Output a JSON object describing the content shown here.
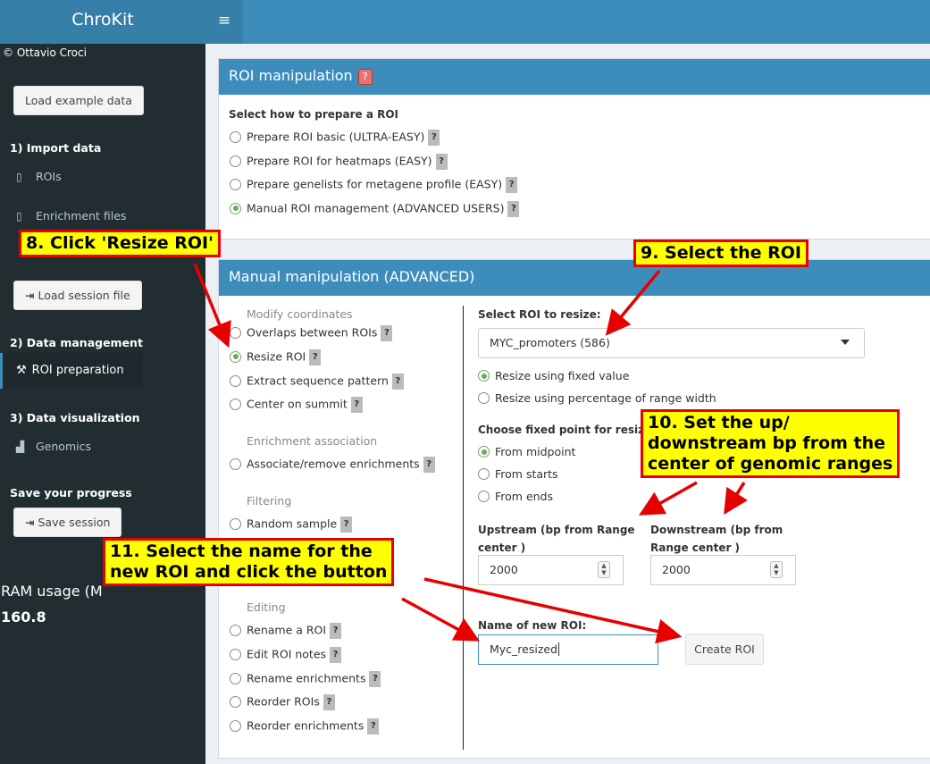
{
  "header": {
    "app_title": "ChroKit",
    "menu_icon": "hamburger-icon",
    "toggle_glyph": "≡"
  },
  "sidebar": {
    "copyright": "© Ottavio Croci",
    "load_example_label": "Load example data",
    "import_heading": "1) Import data",
    "rois_label": "ROIs",
    "enrichment_label": "Enrichment files",
    "load_session_label": "Load session file",
    "data_mgmt_heading": "2) Data management",
    "roi_prep_label": "ROI preparation",
    "data_vis_heading": "3) Data visualization",
    "genomics_label": "Genomics",
    "save_heading": "Save your progress",
    "save_session_label": "Save session",
    "ram_label": "RAM usage (M",
    "ram_value": "160.8"
  },
  "roi_box": {
    "title": "ROI manipulation",
    "help": "?",
    "prompt": "Select how to prepare a ROI",
    "options": [
      {
        "label": "Prepare ROI basic (ULTRA-EASY)",
        "selected": false
      },
      {
        "label": "Prepare ROI for heatmaps (EASY)",
        "selected": false
      },
      {
        "label": "Prepare genelists for metagene profile (EASY)",
        "selected": false
      },
      {
        "label": "Manual ROI management (ADVANCED USERS)",
        "selected": true
      }
    ]
  },
  "manual_box": {
    "title": "Manual manipulation (ADVANCED)",
    "groups": {
      "modify": "Modify coordinates",
      "enrichment": "Enrichment association",
      "filtering": "Filtering",
      "editing": "Editing"
    },
    "actions": {
      "overlaps": "Overlaps between ROIs",
      "resize": "Resize ROI",
      "extract": "Extract sequence pattern",
      "center": "Center on summit",
      "associate": "Associate/remove enrichments",
      "random": "Random sample",
      "rename_roi": "Rename a ROI",
      "edit_notes": "Edit ROI notes",
      "rename_enrich": "Rename enrichments",
      "reorder_rois": "Reorder ROIs",
      "reorder_enrich": "Reorder enrichments"
    },
    "selected_action": "resize",
    "resize_panel": {
      "select_label": "Select ROI to resize:",
      "select_value": "MYC_promoters (586)",
      "mode_fixed": "Resize using fixed value",
      "mode_percent": "Resize using percentage of range width",
      "mode_selected": "fixed",
      "fixed_point_label": "Choose fixed point for resize:",
      "fp_midpoint": "From midpoint",
      "fp_starts": "From starts",
      "fp_ends": "From ends",
      "fp_selected": "midpoint",
      "upstream_label_1": "Upstream (bp from Range",
      "upstream_label_2": "center )",
      "upstream_value": "2000",
      "downstream_label_1": "Downstream (bp from",
      "downstream_label_2": "Range center )",
      "downstream_value": "2000",
      "name_label": "Name of new ROI:",
      "name_value": "Myc_resized",
      "create_label": "Create ROI"
    }
  },
  "callouts": {
    "c8": "8. Click 'Resize ROI'",
    "c9": "9. Select the ROI",
    "c10": "10. Set the up/\ndownstream bp from the\ncenter of genomic ranges",
    "c11": "11. Select the name for the\nnew ROI and click the button"
  },
  "colors": {
    "header": "#3c8dbc",
    "logo": "#367fa9",
    "sidebar": "#222d32",
    "callout_fill": "#ffff00",
    "callout_border": "#e60000",
    "radio_on": "#6ea864"
  }
}
